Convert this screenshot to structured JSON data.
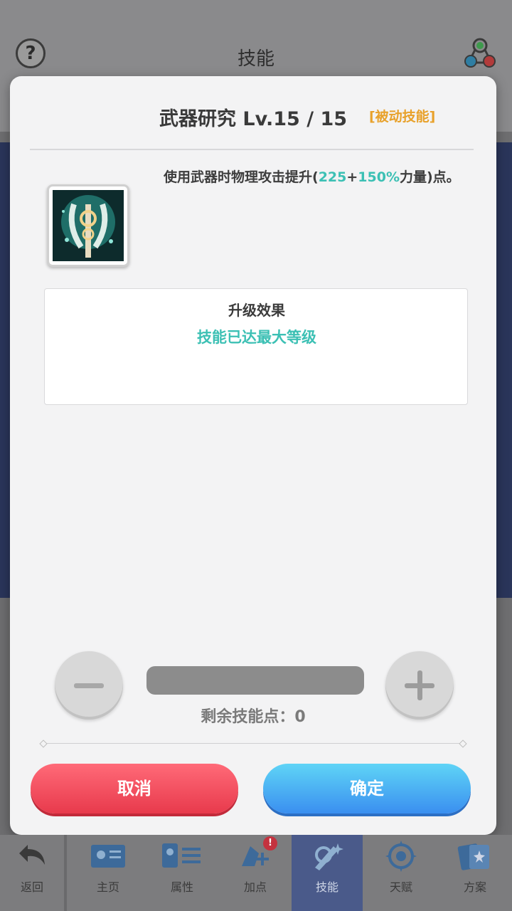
{
  "header": {
    "title": "技能",
    "help_label": "?"
  },
  "dialog": {
    "skill_name": "武器研究 Lv.15 / 15",
    "skill_type": "[被动技能]",
    "desc_before": "使用武器时物理攻击提升(",
    "desc_val1": "225",
    "desc_plus": "+",
    "desc_val2": "150%",
    "desc_after": "力量)点。",
    "upgrade_title": "升级效果",
    "upgrade_text": "技能已达最大等级",
    "points_text": "剩余技能点：0",
    "cancel_label": "取消",
    "confirm_label": "确定"
  },
  "nav": {
    "items": [
      {
        "label": "返回",
        "icon": "back-arrow-icon"
      },
      {
        "label": "主页",
        "icon": "id-card-icon"
      },
      {
        "label": "属性",
        "icon": "attributes-icon"
      },
      {
        "label": "加点",
        "icon": "add-point-icon",
        "badge": "!"
      },
      {
        "label": "技能",
        "icon": "skill-icon",
        "active": true
      },
      {
        "label": "天赋",
        "icon": "talent-icon"
      },
      {
        "label": "方案",
        "icon": "cards-icon"
      }
    ]
  },
  "colors": {
    "accent_teal": "#3cc0b4",
    "skill_type_orange": "#e8a12a",
    "cancel_red": "#e83a4c",
    "confirm_blue": "#3a8ff0"
  }
}
